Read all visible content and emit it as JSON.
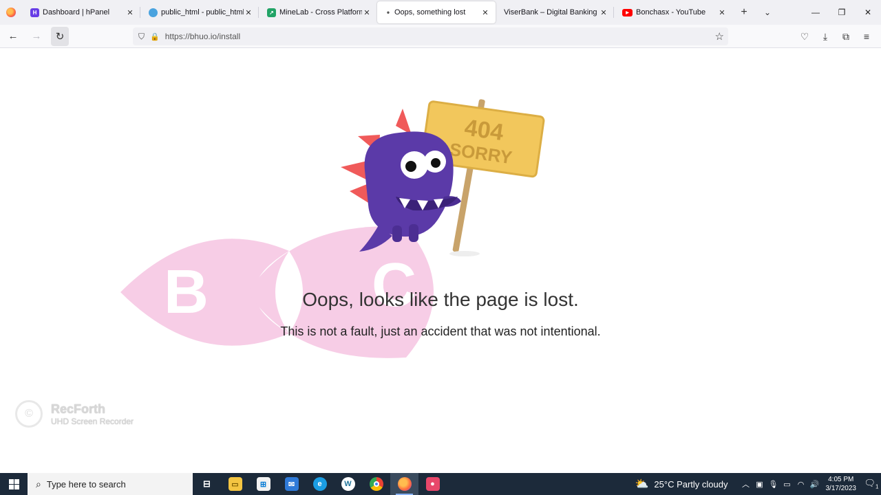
{
  "browser": {
    "tabs": [
      {
        "title": "Dashboard | hPanel",
        "favicon": "hpanel-icon",
        "color": "#673de6",
        "active": false
      },
      {
        "title": "public_html - public_html - [",
        "favicon": "filemanager-icon",
        "color": "#4aa3df",
        "active": false
      },
      {
        "title": "MineLab - Cross Platform Mi",
        "favicon": "minelab-icon",
        "color": "#21a366",
        "active": false
      },
      {
        "title": "Oops, something lost",
        "favicon": "dot-icon",
        "color": "#555555",
        "active": true
      },
      {
        "title": "ViserBank – Digital Banking Syst",
        "favicon": "none",
        "color": "#ffffff",
        "active": false
      },
      {
        "title": "Bonchasx - YouTube",
        "favicon": "youtube-icon",
        "color": "#ff0000",
        "active": false
      }
    ],
    "url": "https://bhuo.io/install"
  },
  "page": {
    "headline": "Oops, looks like the page is lost.",
    "subline": "This is not a fault, just an accident that was not intentional.",
    "sign_line1": "404",
    "sign_line2": "SORRY",
    "watermark_left": "B",
    "watermark_right": "C"
  },
  "overlay": {
    "name": "RecForth",
    "subtitle": "UHD Screen Recorder"
  },
  "taskbar": {
    "search_placeholder": "Type here to search",
    "weather": "25°C  Partly cloudy",
    "time": "4:05 PM",
    "date": "3/17/2023",
    "notification_count": "1"
  }
}
